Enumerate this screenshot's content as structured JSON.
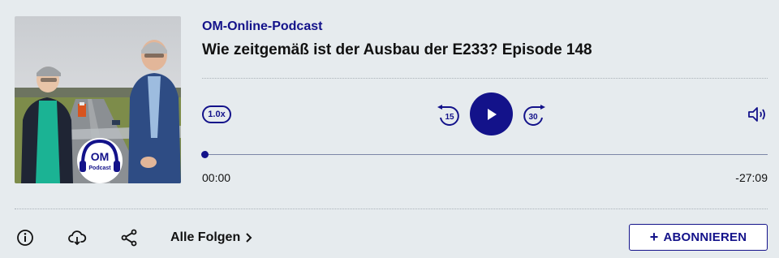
{
  "podcast": {
    "name": "OM-Online-Podcast"
  },
  "episode": {
    "title": "Wie zeitgemäß ist der Ausbau der E233? Episode 148"
  },
  "cover": {
    "logo_line1": "OM",
    "logo_line2": "Podcast",
    "icon": "cover-photo"
  },
  "player": {
    "speed": "1.0x",
    "rewind_seconds": "15",
    "forward_seconds": "30",
    "elapsed": "00:00",
    "remaining": "-27:09",
    "progress": 0
  },
  "footer": {
    "all_episodes": "Alle Folgen",
    "subscribe": "ABONNIEREN",
    "subscribe_icon": "+"
  },
  "colors": {
    "accent": "#13128a",
    "background": "#e6ebee"
  }
}
